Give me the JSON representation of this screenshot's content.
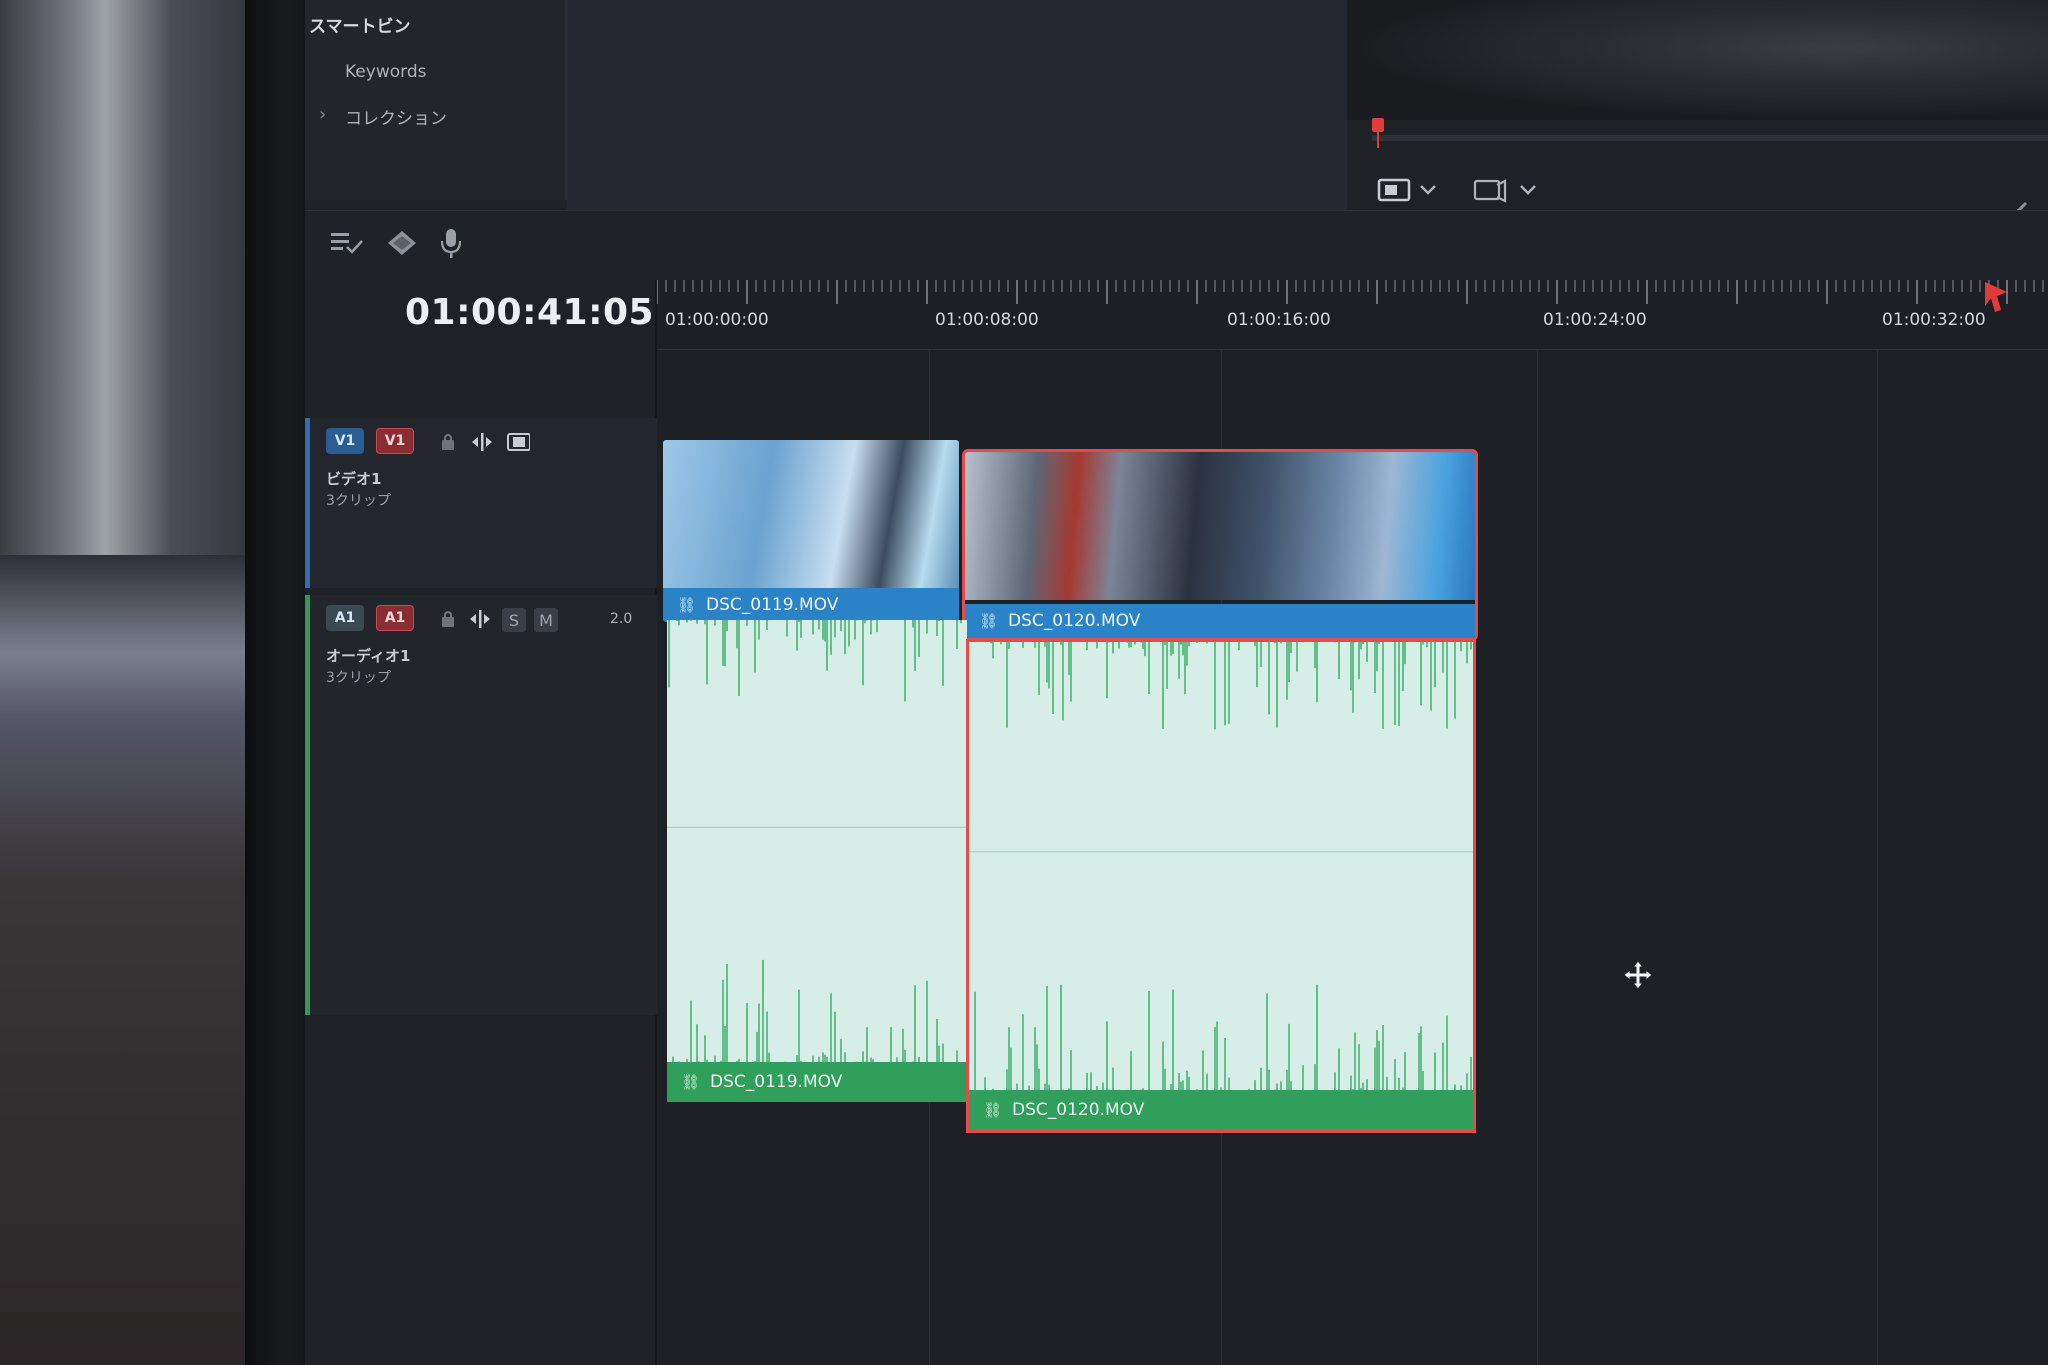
{
  "smart_bins": {
    "title": "スマートビン",
    "items": [
      "Keywords",
      "コレクション"
    ]
  },
  "timeline": {
    "timecode": "01:00:41:05",
    "ruler_labels": [
      "01:00:00:00",
      "01:00:08:00",
      "01:00:16:00",
      "01:00:24:00",
      "01:00:32:00"
    ],
    "video_track": {
      "tag": "V1",
      "tag_dest": "V1",
      "name": "ビデオ1",
      "count": "3クリップ"
    },
    "audio_track": {
      "tag": "A1",
      "tag_dest": "A1",
      "name": "オーディオ1",
      "count": "3クリップ",
      "solo": "S",
      "mute": "M",
      "channels": "2.0"
    },
    "clips": {
      "video1": "DSC_0119.MOV",
      "video2": "DSC_0120.MOV",
      "audio1": "DSC_0119.MOV",
      "audio2": "DSC_0120.MOV"
    }
  },
  "colors": {
    "video_clip": "#2a83c6",
    "audio_clip": "#2f9f5b",
    "selection": "#e34c4c",
    "playhead": "#e23b3b"
  },
  "icons": {
    "toolbar": [
      "list-check-icon",
      "marker-diamond-icon",
      "microphone-icon"
    ],
    "viewer": [
      "display-mode-icon",
      "chevron-down-icon",
      "audio-output-icon",
      "chevron-down-icon"
    ],
    "cursor": "move-cursor-icon"
  }
}
